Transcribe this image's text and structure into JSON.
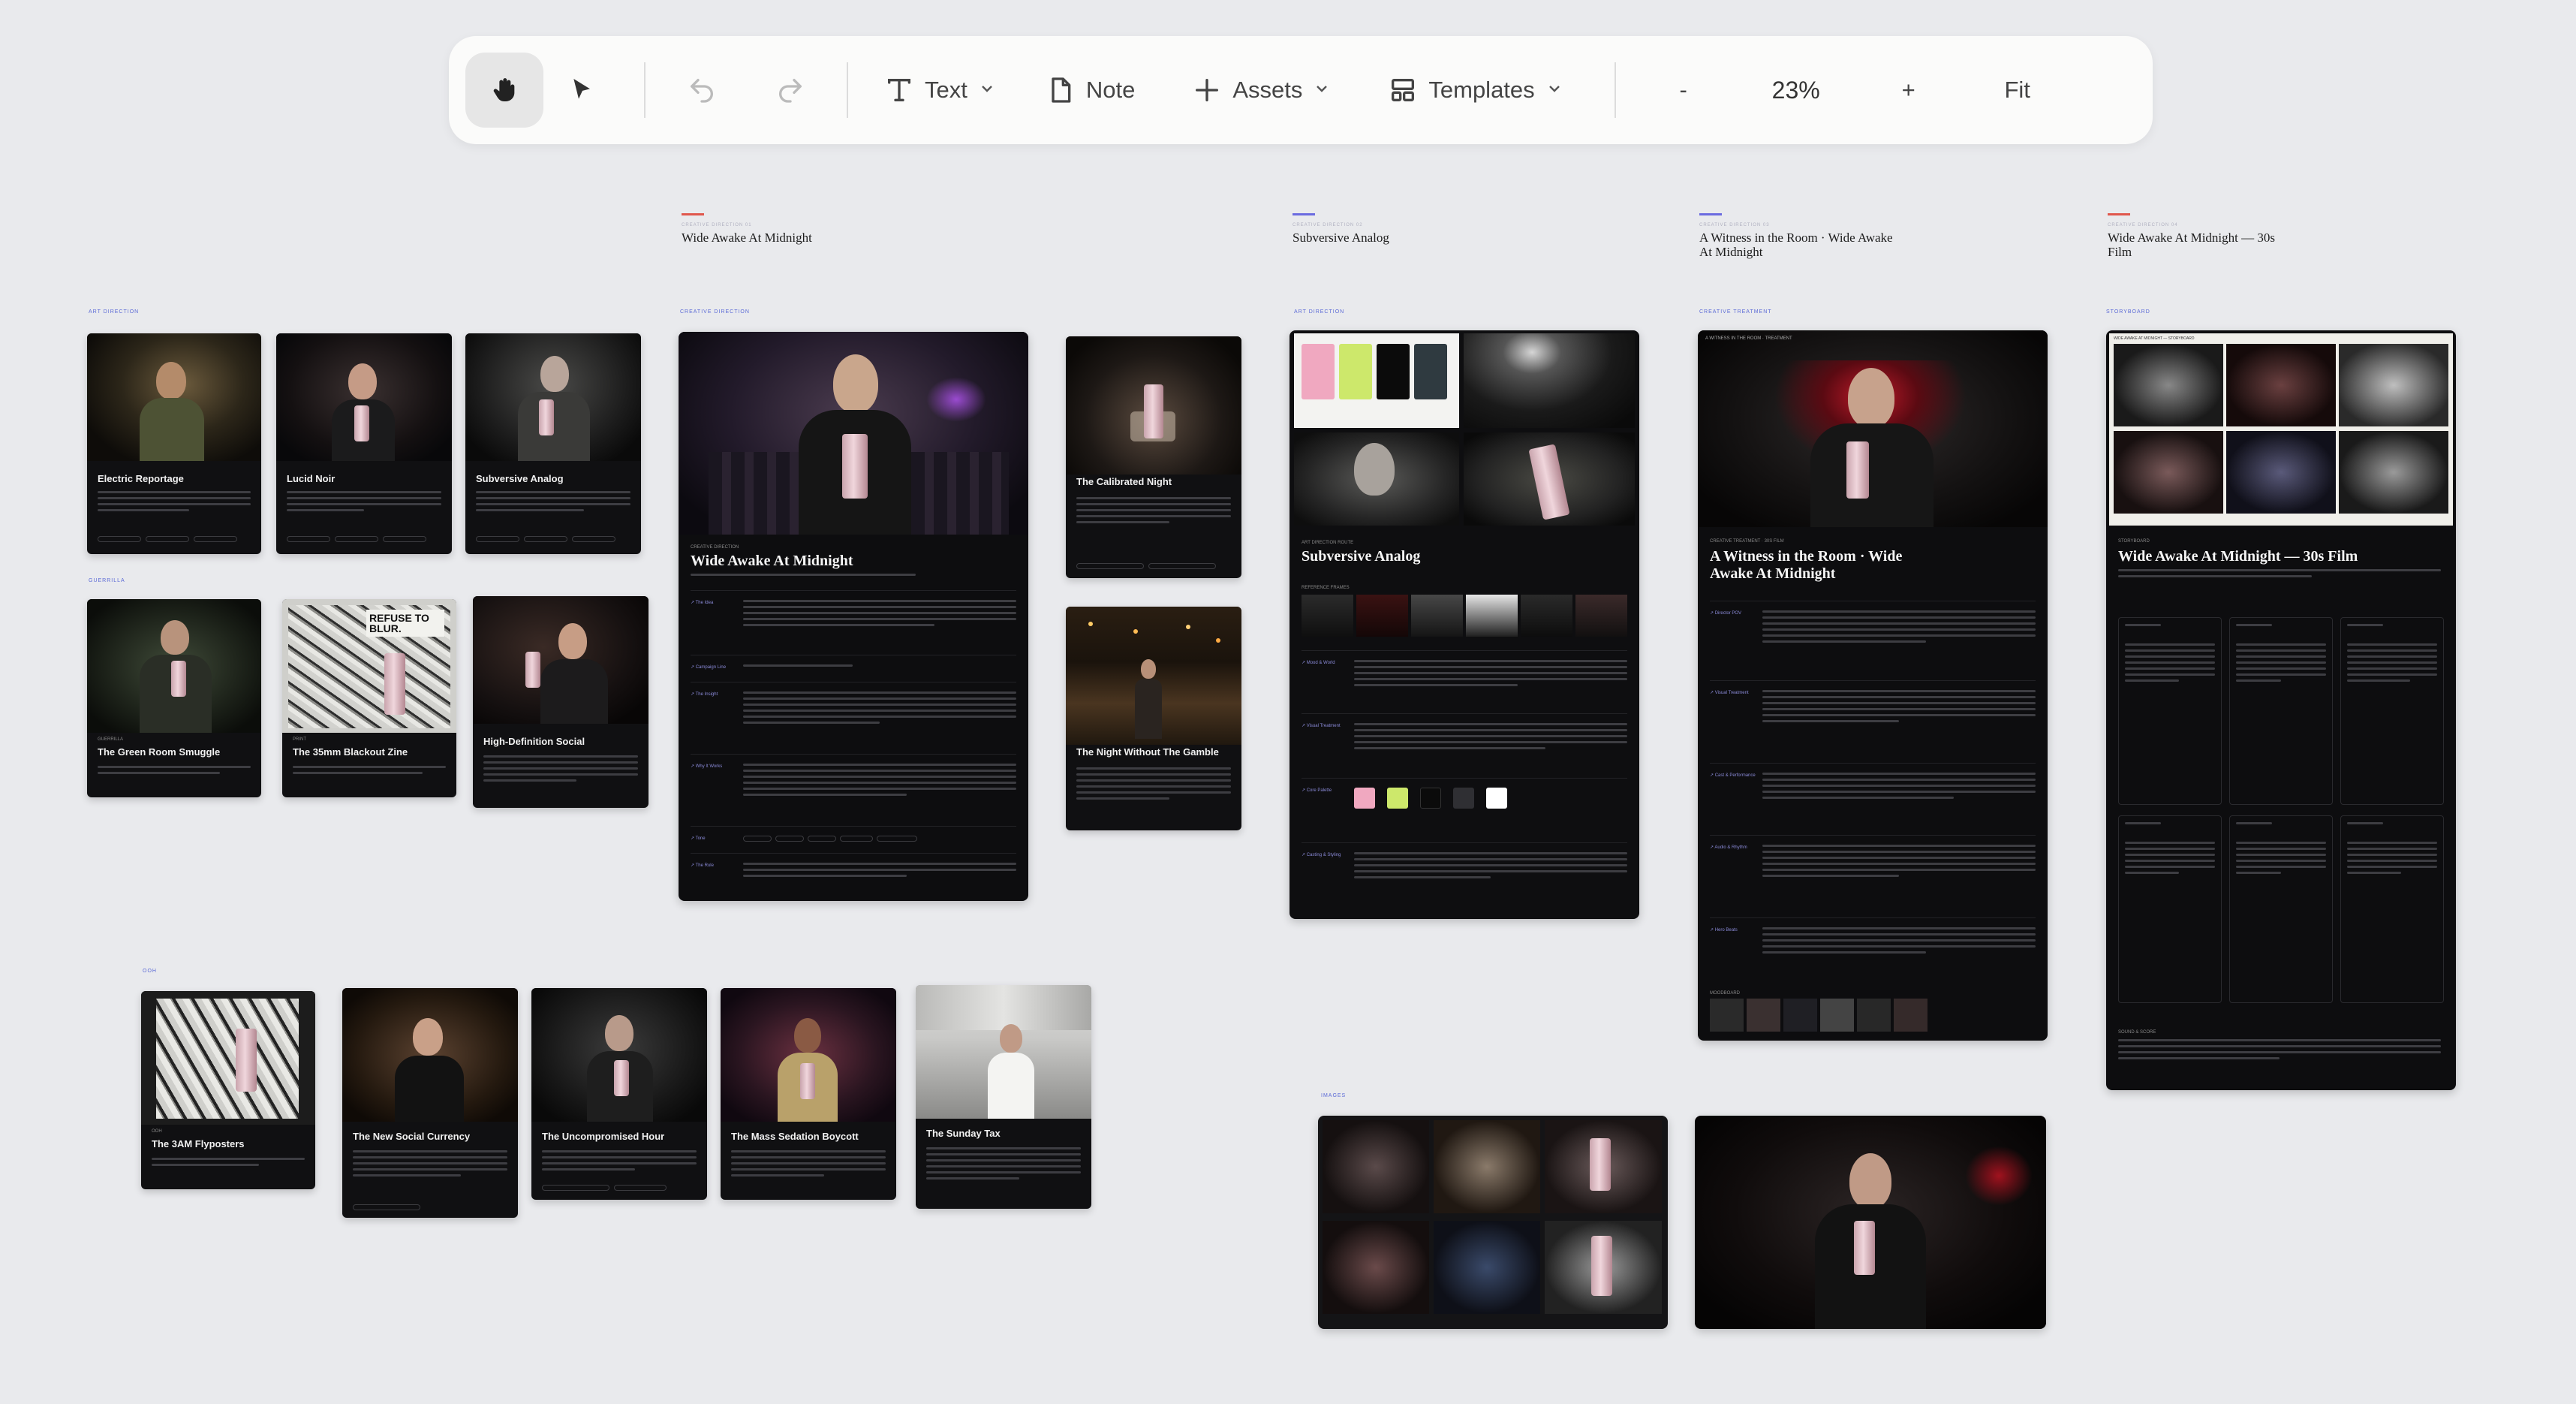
{
  "toolbar": {
    "text_label": "Text",
    "note_label": "Note",
    "assets_label": "Assets",
    "templates_label": "Templates",
    "zoom_out_label": "-",
    "zoom_value": "23%",
    "zoom_in_label": "+",
    "fit_label": "Fit"
  },
  "canvas": {
    "cards": [
      {
        "title": "Electric Reportage"
      },
      {
        "title": "Lucid Noir"
      },
      {
        "title": "Subversive Analog"
      },
      {
        "title": "The Green Room Smuggle"
      },
      {
        "title": "The 35mm Blackout Zine"
      },
      {
        "title": "High-Definition Social"
      },
      {
        "title": "The Calibrated Night"
      },
      {
        "title": "The Night Without The Gamble"
      },
      {
        "title": "The 3AM Flyposters"
      },
      {
        "title": "The New Social Currency"
      },
      {
        "title": "The Uncompromised Hour"
      },
      {
        "title": "The Mass Sedation Boycott"
      },
      {
        "title": "The Sunday Tax"
      }
    ],
    "directions": [
      {
        "title": "Wide Awake At Midnight",
        "color": "#e0574c"
      },
      {
        "title": "Subversive Analog",
        "color": "#6b6be0"
      },
      {
        "title": "A Witness in the Room · Wide Awake At Midnight",
        "color": "#6b6be0"
      },
      {
        "title": "Wide Awake At Midnight — 30s Film",
        "color": "#e0574c"
      }
    ],
    "docs": {
      "doc1_title": "Wide Awake At Midnight",
      "doc2_title": "Subversive Analog",
      "doc3_title": "A Witness in the Room · Wide Awake At Midnight",
      "doc4_title": "Wide Awake At Midnight — 30s Film"
    },
    "zine_sign": "REFUSE TO BLUR.",
    "swatches": [
      "#f0a8c0",
      "#cde86b",
      "#0b0b0b",
      "#2f2f33",
      "#ffffff"
    ]
  }
}
